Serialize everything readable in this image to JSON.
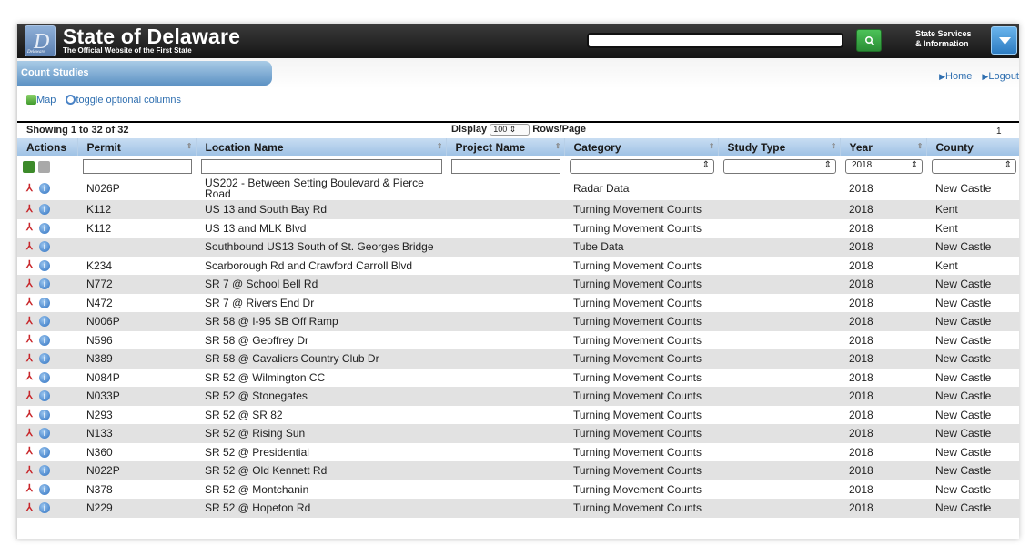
{
  "header": {
    "logo_text": "Delaware",
    "title": "State of Delaware",
    "tagline": "The Official Website of the First State",
    "search_value": "",
    "services_line1": "State Services",
    "services_line2": "& Information"
  },
  "section": {
    "tab_label": "Count Studies"
  },
  "nav": {
    "home": "Home",
    "logout": "Logout"
  },
  "tools": {
    "map": "Map",
    "toggle": "toggle optional columns"
  },
  "table_info": {
    "showing": "Showing 1 to 32 of 32",
    "display_label": "Display",
    "rows_value": "100",
    "rows_label": "Rows/Page",
    "page": "1"
  },
  "columns": [
    "Actions",
    "Permit",
    "Location Name",
    "Project Name",
    "Category",
    "Study Type",
    "Year",
    "County"
  ],
  "filters": {
    "year_value": "2018"
  },
  "rows": [
    {
      "permit": "N026P",
      "location": "US202 - Between Setting Boulevard & Pierce Road",
      "project": "",
      "category": "Radar Data",
      "study_type": "",
      "year": "2018",
      "county": "New Castle"
    },
    {
      "permit": "K112",
      "location": "US 13 and South Bay Rd",
      "project": "",
      "category": "Turning Movement Counts",
      "study_type": "",
      "year": "2018",
      "county": "Kent"
    },
    {
      "permit": "K112",
      "location": "US 13 and MLK Blvd",
      "project": "",
      "category": "Turning Movement Counts",
      "study_type": "",
      "year": "2018",
      "county": "Kent"
    },
    {
      "permit": "",
      "location": "Southbound US13 South of St. Georges Bridge",
      "project": "",
      "category": "Tube Data",
      "study_type": "",
      "year": "2018",
      "county": "New Castle"
    },
    {
      "permit": "K234",
      "location": "Scarborough Rd and Crawford Carroll Blvd",
      "project": "",
      "category": "Turning Movement Counts",
      "study_type": "",
      "year": "2018",
      "county": "Kent"
    },
    {
      "permit": "N772",
      "location": "SR 7 @ School Bell Rd",
      "project": "",
      "category": "Turning Movement Counts",
      "study_type": "",
      "year": "2018",
      "county": "New Castle"
    },
    {
      "permit": "N472",
      "location": "SR 7 @ Rivers End Dr",
      "project": "",
      "category": "Turning Movement Counts",
      "study_type": "",
      "year": "2018",
      "county": "New Castle"
    },
    {
      "permit": "N006P",
      "location": "SR 58 @ I-95 SB Off Ramp",
      "project": "",
      "category": "Turning Movement Counts",
      "study_type": "",
      "year": "2018",
      "county": "New Castle"
    },
    {
      "permit": "N596",
      "location": "SR 58 @ Geoffrey Dr",
      "project": "",
      "category": "Turning Movement Counts",
      "study_type": "",
      "year": "2018",
      "county": "New Castle"
    },
    {
      "permit": "N389",
      "location": "SR 58 @ Cavaliers Country Club Dr",
      "project": "",
      "category": "Turning Movement Counts",
      "study_type": "",
      "year": "2018",
      "county": "New Castle"
    },
    {
      "permit": "N084P",
      "location": "SR 52 @ Wilmington CC",
      "project": "",
      "category": "Turning Movement Counts",
      "study_type": "",
      "year": "2018",
      "county": "New Castle"
    },
    {
      "permit": "N033P",
      "location": "SR 52 @ Stonegates",
      "project": "",
      "category": "Turning Movement Counts",
      "study_type": "",
      "year": "2018",
      "county": "New Castle"
    },
    {
      "permit": "N293",
      "location": "SR 52 @ SR 82",
      "project": "",
      "category": "Turning Movement Counts",
      "study_type": "",
      "year": "2018",
      "county": "New Castle"
    },
    {
      "permit": "N133",
      "location": "SR 52 @ Rising Sun",
      "project": "",
      "category": "Turning Movement Counts",
      "study_type": "",
      "year": "2018",
      "county": "New Castle"
    },
    {
      "permit": "N360",
      "location": "SR 52 @ Presidential",
      "project": "",
      "category": "Turning Movement Counts",
      "study_type": "",
      "year": "2018",
      "county": "New Castle"
    },
    {
      "permit": "N022P",
      "location": "SR 52 @ Old Kennett Rd",
      "project": "",
      "category": "Turning Movement Counts",
      "study_type": "",
      "year": "2018",
      "county": "New Castle"
    },
    {
      "permit": "N378",
      "location": "SR 52 @ Montchanin",
      "project": "",
      "category": "Turning Movement Counts",
      "study_type": "",
      "year": "2018",
      "county": "New Castle"
    },
    {
      "permit": "N229",
      "location": "SR 52 @ Hopeton Rd",
      "project": "",
      "category": "Turning Movement Counts",
      "study_type": "",
      "year": "2018",
      "county": "New Castle"
    }
  ]
}
